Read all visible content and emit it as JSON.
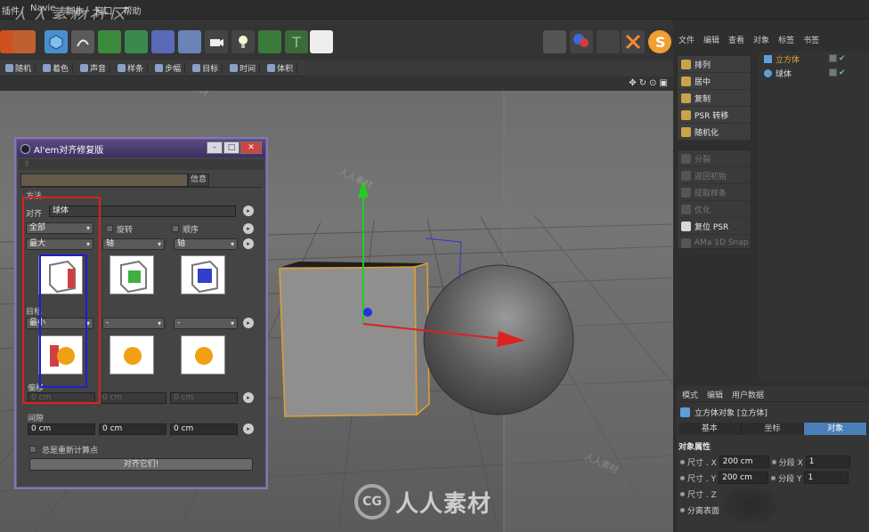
{
  "menubar": {
    "items": [
      "插件",
      "Navie",
      "脚本",
      "窗口",
      "帮助"
    ],
    "watermark": "人人素材社区"
  },
  "toolbar2": [
    "随机",
    "着色",
    "声音",
    "样条",
    "步幅",
    "目标",
    "时间",
    "体积"
  ],
  "object_manager": {
    "menu": [
      "文件",
      "编辑",
      "查看",
      "对象",
      "标签",
      "书签"
    ],
    "objects": [
      {
        "name": "立方体",
        "color": "#e0a040"
      },
      {
        "name": "球体",
        "color": "#dddddd"
      }
    ]
  },
  "commands_top": [
    "排列",
    "居中",
    "复制",
    "PSR 转移",
    "随机化"
  ],
  "commands_bottom": [
    "分裂",
    "返回初始",
    "提取样条",
    "优化",
    "复位 PSR",
    "AMa 1D Snap"
  ],
  "attributes": {
    "menu": [
      "模式",
      "编辑",
      "用户数据"
    ],
    "title": "立方体对象 [立方体]",
    "tabs": [
      "基本",
      "坐标",
      "对象"
    ],
    "active_tab": "对象",
    "section": "对象属性",
    "rows": [
      {
        "label": "尺寸 . X",
        "value": "200 cm",
        "seg_label": "分段 X",
        "seg_value": "1"
      },
      {
        "label": "尺寸 . Y",
        "value": "200 cm",
        "seg_label": "分段 Y",
        "seg_value": "1"
      },
      {
        "label": "尺寸 . Z",
        "value": "",
        "seg_label": "",
        "seg_value": ""
      }
    ],
    "last_label": "分离表面"
  },
  "dialog": {
    "title": "Al'em对齐修复版",
    "tab_info": "信息",
    "section_align": "方法",
    "align_label": "对齐",
    "align_value": "球体",
    "mode_select": "全部",
    "rotate_label": "旋转",
    "order_label": "顺序",
    "max_select": "最大",
    "axis1": "轴",
    "axis2": "轴",
    "target_label": "目标",
    "min_select": "最小",
    "dash1": "-",
    "dash2": "-",
    "offset_label": "偏移",
    "offset_values": [
      "0 cm",
      "0 cm",
      "0 cm"
    ],
    "spacing_label": "间隙",
    "spacing_values": [
      "0 cm",
      "0 cm",
      "0 cm"
    ],
    "recalc_label": "总是重新计算点",
    "align_button": "对齐它们!"
  },
  "watermark_text": "人人素材",
  "watermark_logo": "CG"
}
